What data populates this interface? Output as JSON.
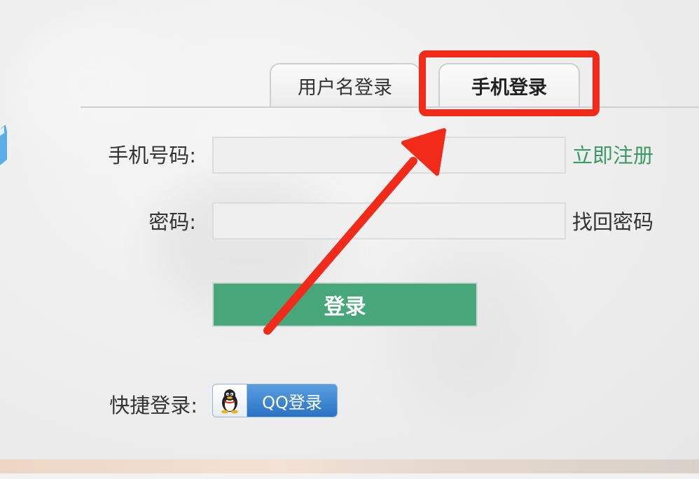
{
  "tabs": {
    "username_label": "用户名登录",
    "mobile_label": "手机登录",
    "active": "手机登录"
  },
  "form": {
    "phone_label": "手机号码:",
    "phone_value": "",
    "phone_placeholder": "",
    "password_label": "密码:",
    "password_value": "",
    "password_placeholder": "",
    "register_link": "立即注册",
    "forgot_link": "找回密码",
    "login_button": "登录"
  },
  "quick_login": {
    "label": "快捷登录:",
    "qq_button": "QQ登录"
  },
  "colors": {
    "accent_green": "#47a77a",
    "register_green": "#3c9a64",
    "annotation_red": "#f12a1a",
    "qq_blue": "#2a73c4"
  },
  "icons": {
    "qq": "qq-penguin-icon"
  },
  "annotations": {
    "highlight": "mobile-login-tab",
    "arrow_target": "mobile-login-tab"
  }
}
